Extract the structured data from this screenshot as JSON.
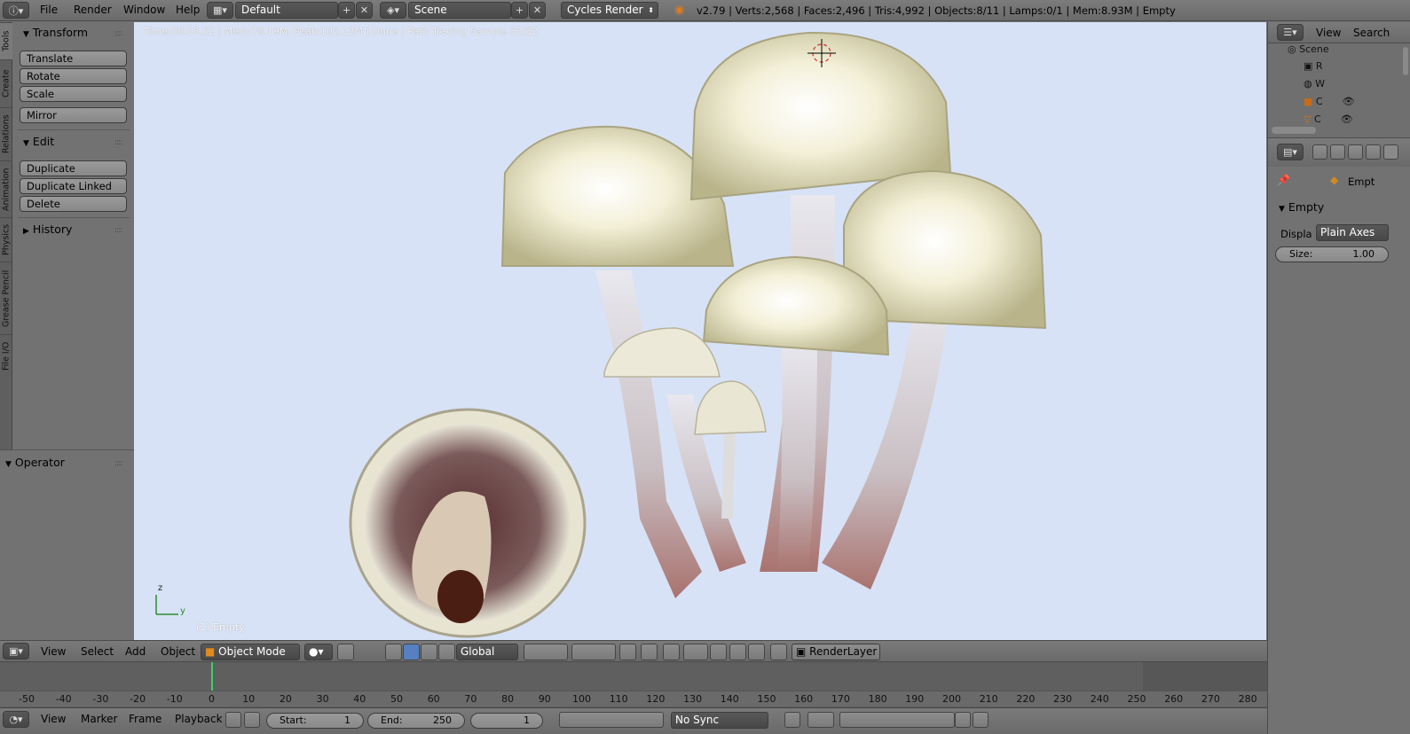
{
  "topbar": {
    "menus": [
      "File",
      "Render",
      "Window",
      "Help"
    ],
    "screen_layout": "Default",
    "scene": "Scene",
    "render_engine": "Cycles Render",
    "stats": "v2.79 | Verts:2,568 | Faces:2,496 | Tris:4,992 | Objects:8/11 | Lamps:0/1 | Mem:8.93M | Empty"
  },
  "tool_tabs": [
    "Tools",
    "Create",
    "Relations",
    "Animation",
    "Physics",
    "Grease Pencil",
    "File I/O"
  ],
  "tools": {
    "transform_header": "Transform",
    "transform_buttons": [
      "Translate",
      "Rotate",
      "Scale",
      "Mirror"
    ],
    "edit_header": "Edit",
    "edit_buttons": [
      "Duplicate",
      "Duplicate Linked",
      "Delete"
    ],
    "history_header": "History"
  },
  "operator": {
    "header": "Operator"
  },
  "viewport": {
    "status": "Time:00:18.52 | Mem:78.19M, Peak:102.12M | Done | Path Tracing Sample 32/32",
    "object_label": "(1) Empty",
    "axis_z": "z",
    "axis_y": "y"
  },
  "outliner": {
    "view_menu": "View",
    "search_menu": "Search",
    "rows": [
      "Scene",
      "R",
      "W",
      "C",
      "C"
    ]
  },
  "properties": {
    "breadcrumb": "Empt",
    "panel_header": "Empty",
    "display_label": "Displa",
    "display_value": "Plain Axes",
    "size_label": "Size:",
    "size_value": "1.00"
  },
  "view3d_header": {
    "menus": [
      "View",
      "Select",
      "Add",
      "Object"
    ],
    "mode": "Object Mode",
    "orientation": "Global",
    "render_layer": "RenderLayer"
  },
  "timeline": {
    "ticks": [
      "-50",
      "-40",
      "-30",
      "-20",
      "-10",
      "0",
      "10",
      "20",
      "30",
      "40",
      "50",
      "60",
      "70",
      "80",
      "90",
      "100",
      "110",
      "120",
      "130",
      "140",
      "150",
      "160",
      "170",
      "180",
      "190",
      "200",
      "210",
      "220",
      "230",
      "240",
      "250",
      "260",
      "270",
      "280"
    ],
    "current_frame_marker": 0
  },
  "timeline_footer": {
    "menus": [
      "View",
      "Marker",
      "Frame",
      "Playback"
    ],
    "start_label": "Start:",
    "start_value": "1",
    "end_label": "End:",
    "end_value": "250",
    "current_frame": "1",
    "sync": "No Sync"
  },
  "colors": {
    "viewport_bg": "#d8e2f7",
    "panel_bg": "#727272",
    "accent_frame": "#3dd16b"
  }
}
